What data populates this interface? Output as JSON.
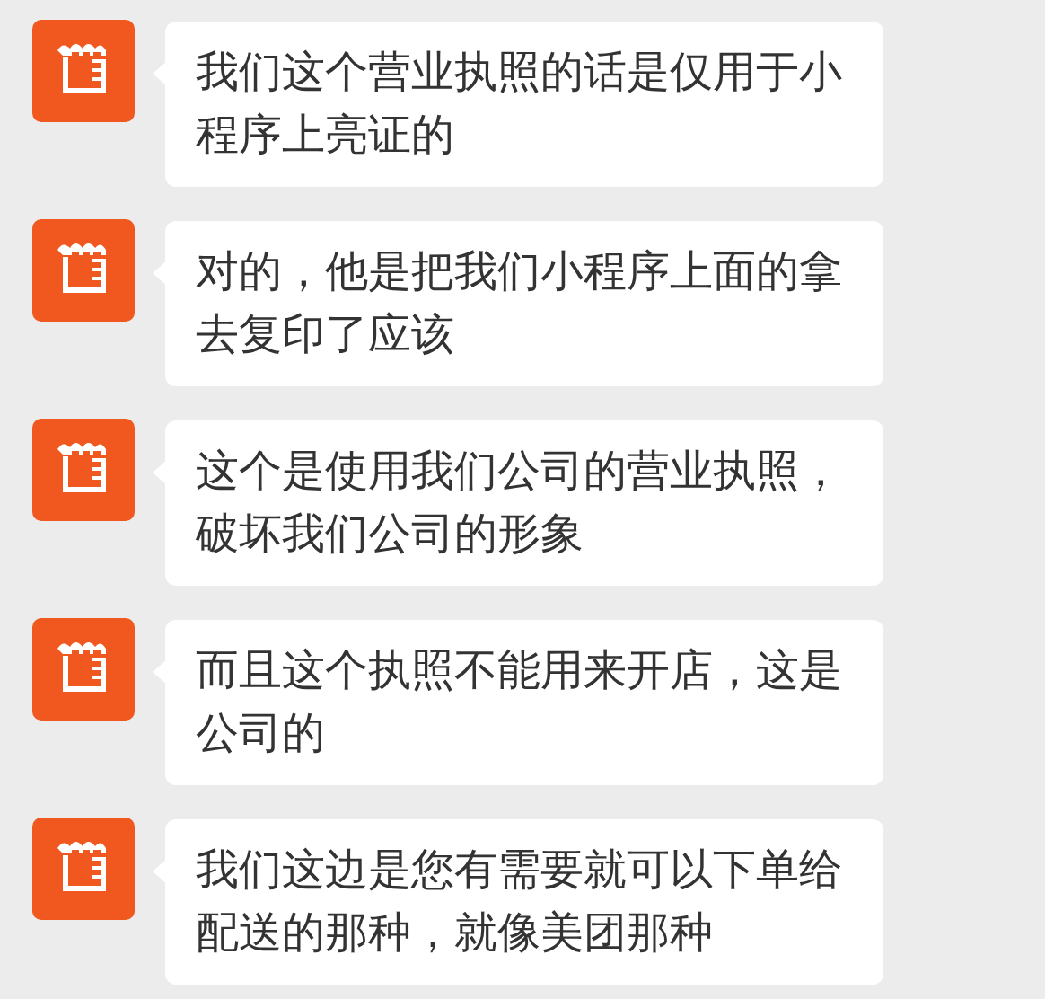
{
  "messages": [
    {
      "text": "我们这个营业执照的话是仅用于小程序上亮证的"
    },
    {
      "text": "对的，他是把我们小程序上面的拿去复印了应该"
    },
    {
      "text": "这个是使用我们公司的营业执照，破坏我们公司的形象"
    },
    {
      "text": "而且这个执照不能用来开店，这是公司的"
    },
    {
      "text": "我们这边是您有需要就可以下单给配送的那种，就像美团那种"
    }
  ]
}
